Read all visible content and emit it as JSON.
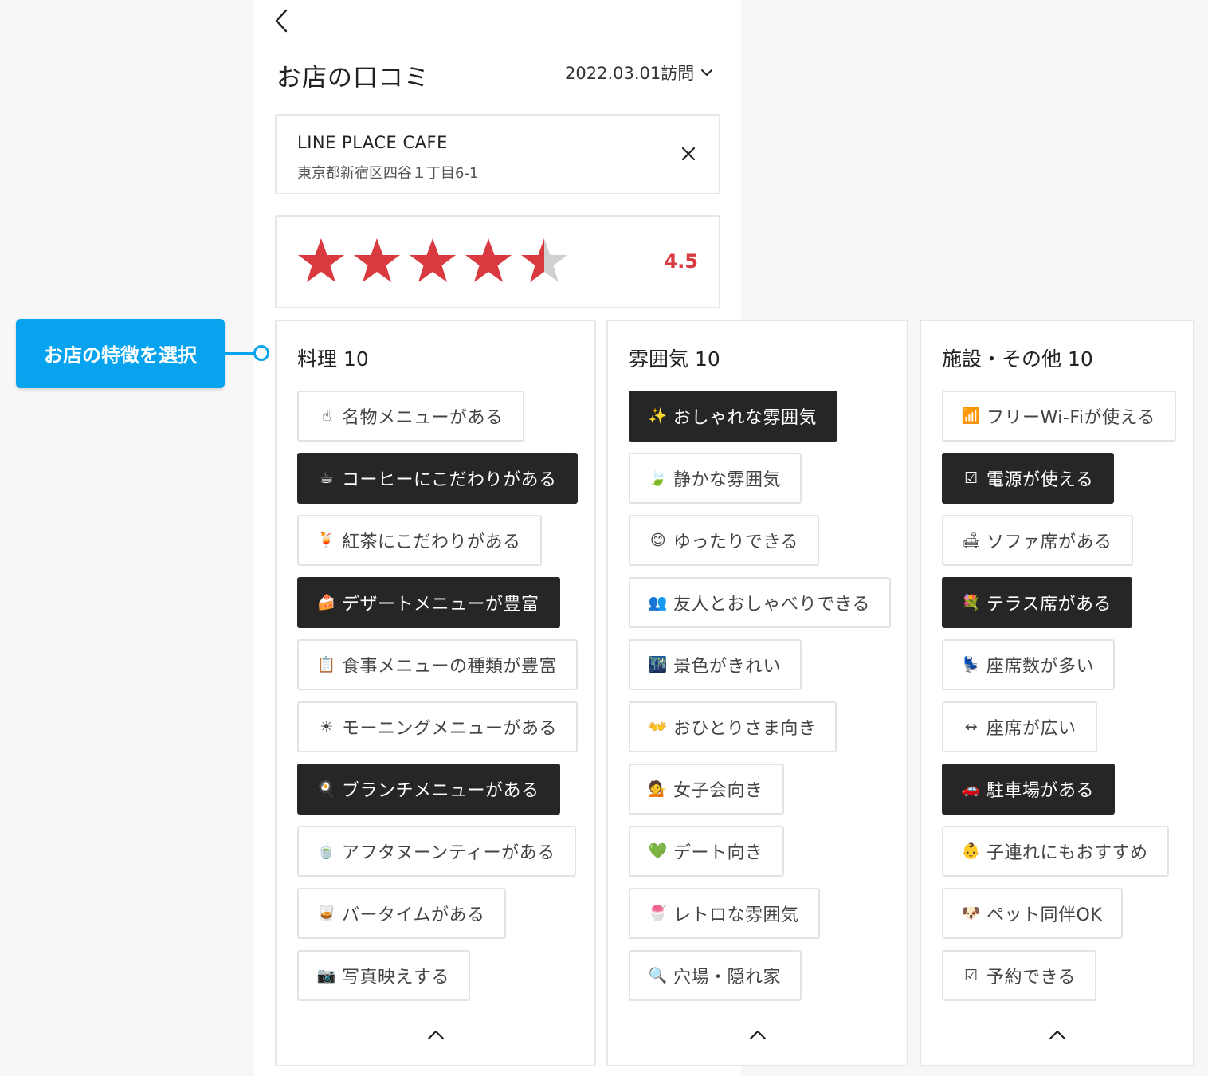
{
  "header": {
    "title": "お店の口コミ",
    "visit_date": "2022.03.01訪問"
  },
  "shop": {
    "name": "LINE PLACE CAFE",
    "address": "東京都新宿区四谷１丁目6-1"
  },
  "rating": {
    "value": "4.5",
    "stars_filled": 4.5,
    "stars_total": 5,
    "star_color": "#d93a3f",
    "star_empty_color": "#d0d0d0"
  },
  "callout": {
    "label": "お店の特徴を選択",
    "color": "#07a3ef"
  },
  "columns": [
    {
      "title": "料理 10",
      "items": [
        {
          "icon": "☝",
          "label": "名物メニューがある",
          "selected": false
        },
        {
          "icon": "☕",
          "label": "コーヒーにこだわりがある",
          "selected": true
        },
        {
          "icon": "🍹",
          "label": "紅茶にこだわりがある",
          "selected": false
        },
        {
          "icon": "🍰",
          "label": "デザートメニューが豊富",
          "selected": true
        },
        {
          "icon": "📋",
          "label": "食事メニューの種類が豊富",
          "selected": false
        },
        {
          "icon": "☀",
          "label": "モーニングメニューがある",
          "selected": false
        },
        {
          "icon": "🍳",
          "label": "ブランチメニューがある",
          "selected": true
        },
        {
          "icon": "🍵",
          "label": "アフタヌーンティーがある",
          "selected": false
        },
        {
          "icon": "🥃",
          "label": "バータイムがある",
          "selected": false
        },
        {
          "icon": "📷",
          "label": "写真映えする",
          "selected": false
        }
      ]
    },
    {
      "title": "雰囲気 10",
      "items": [
        {
          "icon": "✨",
          "label": "おしゃれな雰囲気",
          "selected": true
        },
        {
          "icon": "🍃",
          "label": "静かな雰囲気",
          "selected": false
        },
        {
          "icon": "😊",
          "label": "ゆったりできる",
          "selected": false
        },
        {
          "icon": "👥",
          "label": "友人とおしゃべりできる",
          "selected": false
        },
        {
          "icon": "🌃",
          "label": "景色がきれい",
          "selected": false
        },
        {
          "icon": "👐",
          "label": "おひとりさま向き",
          "selected": false
        },
        {
          "icon": "💁",
          "label": "女子会向き",
          "selected": false
        },
        {
          "icon": "💚",
          "label": "デート向き",
          "selected": false
        },
        {
          "icon": "🍧",
          "label": "レトロな雰囲気",
          "selected": false
        },
        {
          "icon": "🔍",
          "label": "穴場・隠れ家",
          "selected": false
        }
      ]
    },
    {
      "title": "施設・その他 10",
      "items": [
        {
          "icon": "📶",
          "label": "フリーWi-Fiが使える",
          "selected": false
        },
        {
          "icon": "☑",
          "label": "電源が使える",
          "selected": true
        },
        {
          "icon": "🛋",
          "label": "ソファ席がある",
          "selected": false
        },
        {
          "icon": "💐",
          "label": "テラス席がある",
          "selected": true
        },
        {
          "icon": "💺",
          "label": "座席数が多い",
          "selected": false
        },
        {
          "icon": "↔",
          "label": "座席が広い",
          "selected": false
        },
        {
          "icon": "🚗",
          "label": "駐車場がある",
          "selected": true
        },
        {
          "icon": "👶",
          "label": "子連れにもおすすめ",
          "selected": false
        },
        {
          "icon": "🐶",
          "label": "ペット同伴OK",
          "selected": false
        },
        {
          "icon": "☑",
          "label": "予約できる",
          "selected": false
        }
      ]
    }
  ]
}
